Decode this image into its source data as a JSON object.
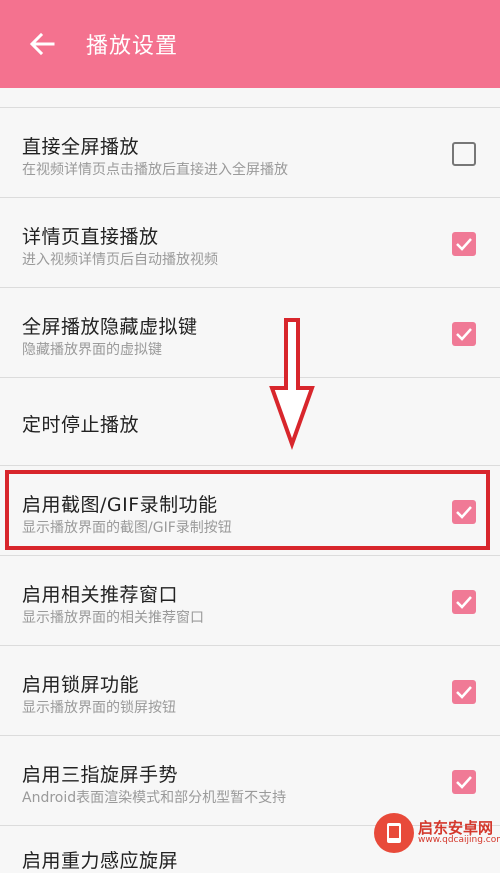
{
  "appbar": {
    "title": "播放设置",
    "color": "#f4728f"
  },
  "settings": [
    {
      "title": "直接全屏播放",
      "subtitle": "在视频详情页点击播放后直接进入全屏播放",
      "checked": false
    },
    {
      "title": "详情页直接播放",
      "subtitle": "进入视频详情页后自动播放视频",
      "checked": true
    },
    {
      "title": "全屏播放隐藏虚拟键",
      "subtitle": "隐藏播放界面的虚拟键",
      "checked": true
    },
    {
      "title": "定时停止播放",
      "subtitle": "",
      "checked": null
    },
    {
      "title": "启用截图/GIF录制功能",
      "subtitle": "显示播放界面的截图/GIF录制按钮",
      "checked": true
    },
    {
      "title": "启用相关推荐窗口",
      "subtitle": "显示播放界面的相关推荐窗口",
      "checked": true
    },
    {
      "title": "启用锁屏功能",
      "subtitle": "显示播放界面的锁屏按钮",
      "checked": true
    },
    {
      "title": "启用三指旋屏手势",
      "subtitle": "Android表面渲染模式和部分机型暂不支持",
      "checked": true
    },
    {
      "title": "启用重力感应旋屏",
      "subtitle": "",
      "checked": null
    }
  ],
  "annotation": {
    "highlight_color": "#d8262c"
  },
  "watermark": {
    "name": "启东安卓网",
    "url": "www.qdcaijing.com"
  }
}
